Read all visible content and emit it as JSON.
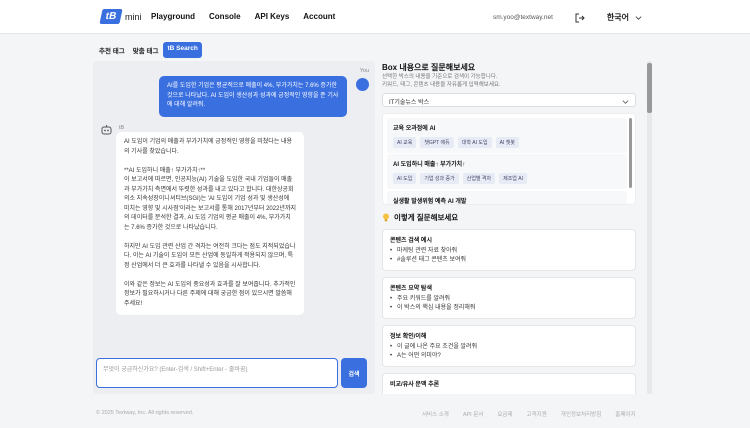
{
  "header": {
    "logo_mark": "tB",
    "logo_text": "mini",
    "nav": [
      "Playground",
      "Console",
      "API Keys",
      "Account"
    ],
    "email": "sm.yoo@textway.net",
    "language": "한국어"
  },
  "tabs": [
    "추천 태그",
    "맞춤 태그",
    "tB Search"
  ],
  "chat": {
    "user_label": "You",
    "user_message": "AI를 도입한 기업은 평균적으로 매출이 4%, 부가가치는 7.6% 증가한 것으로 나타났다. AI 도입이 생산성과 성과에 긍정적인 영향을 준 기사에 대해 알려줘.",
    "bot_label": "tB",
    "bot_message": "AI 도입이 기업의 매출과 부가가치에 긍정적인 영향을 미쳤다는 내용의 기사를 찾았습니다.\n\n**AI 도입하니 매출↑ 부가가치↑**\n이 보고서에 따르면, 인공지능(AI) 기술을 도입한 국내 기업들이 매출과 부가가치 측면에서 뚜렷한 성과를 내고 있다고 합니다. 대한상공회의소 지속성장이니셔티브(SGI)는 'AI 도입이 기업 성과 및 생산성에 미치는 영향 및 시사점'이라는 보고서를 통해 2017년부터 2022년까지의 데이터를 분석한 결과, AI 도입 기업의 평균 매출이 4%, 부가가치는 7.6% 증가한 것으로 나타났습니다.\n\n하지만 AI 도입 관련 산업 간 격차는 여전히 크다는 점도 지적되었습니다. 이는 AI 기술이 도입이 모든 산업에 동일하게 적용되지 않으며, 특정 산업에서 더 큰 효과를 나타낼 수 있음을 시사합니다.\n\n이와 같은 정보는 AI 도입의 중요성과 효과를 잘 보여줍니다. 추가적인 정보가 필요하시거나 다른 주제에 대해 궁금한 점이 있으시면 말씀해 주세요!",
    "input_placeholder": "무엇이 궁금하신가요? (Enter-검색 / Shift+Enter - 줄바꿈)",
    "search_button": "검색"
  },
  "right": {
    "title": "Box 내용으로 질문해보세요",
    "desc_line1": "선택한 박스의 내용을 기준으로 검색이 가능합니다.",
    "desc_line2": "키워드, 태그, 콘텐츠 내용을 자유롭게 입력해보세요.",
    "select_value": "IT기술뉴스 박스",
    "news": [
      {
        "title": "교육 오과정에 AI",
        "tags": [
          "AI 교육",
          "챗GPT 에듀",
          "대학 AI 도입",
          "AI 챗봇"
        ]
      },
      {
        "title": "AI 도입하니 매출↑ 부가가치↑",
        "tags": [
          "AI 도입",
          "기업 성과 증가",
          "산업별 격차",
          "제조업 AI"
        ]
      },
      {
        "title": "실생활 발생위험 예측 AI 개발",
        "tags": []
      }
    ],
    "hint_title": "이렇게 질문해보세요",
    "questions": [
      {
        "title": "콘텐츠 검색 예시",
        "items": [
          "마케팅 관련 자료 찾아줘",
          "#솔루션 태그 콘텐츠 보여줘"
        ]
      },
      {
        "title": "콘텐츠 요약 탐색",
        "items": [
          "주요 키워드를 알려줘",
          "이 박스의 핵심 내용을 정리해줘"
        ]
      },
      {
        "title": "정보 확인/이해",
        "items": [
          "이 글에 나온 주요 조건을 알려줘",
          "A는 어떤 의미야?"
        ]
      },
      {
        "title": "비교/유사 문맥 추론",
        "items": []
      }
    ]
  },
  "footer": {
    "copyright": "© 2025 Textway, Inc. All rights reserved.",
    "links": [
      "서비스 소개",
      "API 문서",
      "요금제",
      "고객지원",
      "개인정보처리방침",
      "홈페이지"
    ]
  },
  "colors": {
    "accent": "#3a6fe0"
  }
}
